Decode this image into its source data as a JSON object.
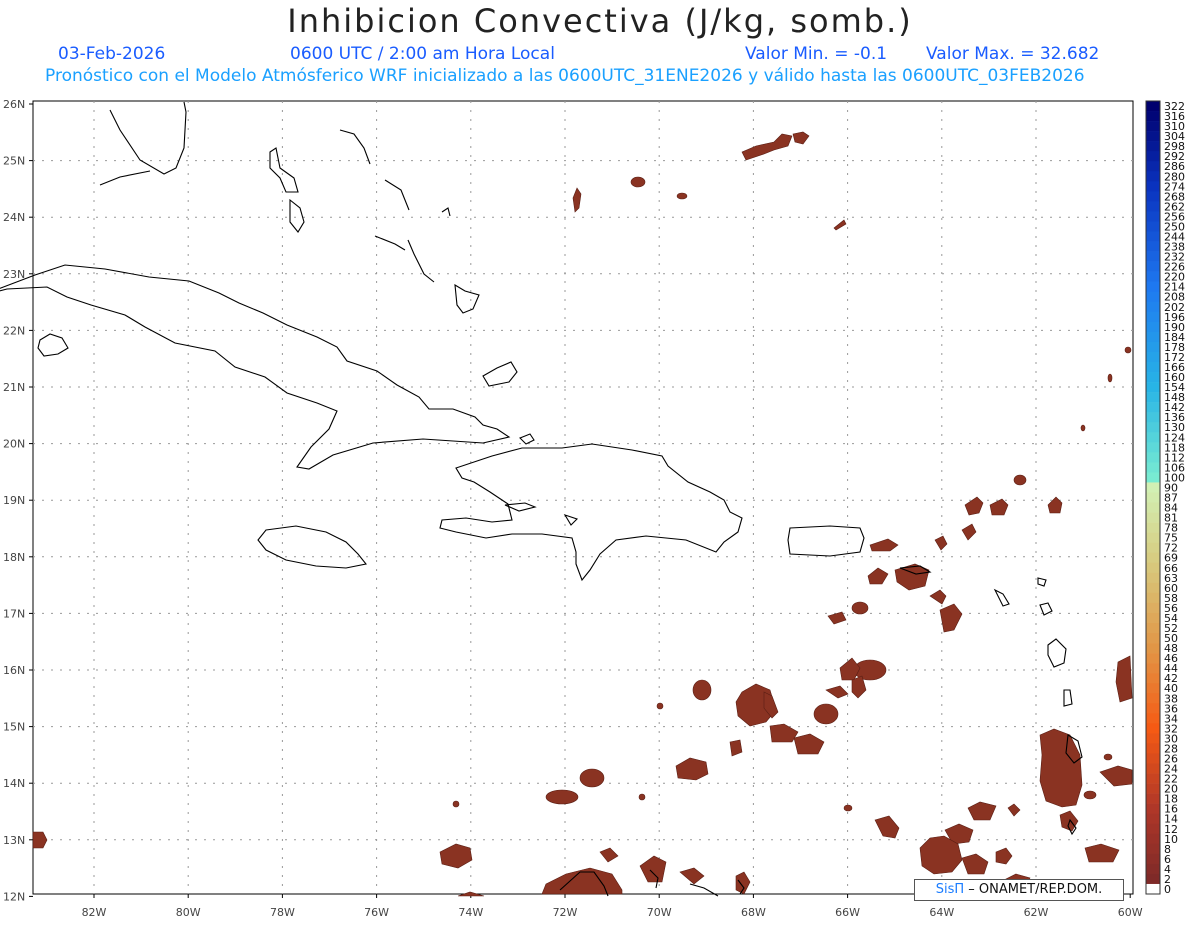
{
  "header": {
    "title": "Inhibicion Convectiva (J/kg, somb.)",
    "date": "03-Feb-2026",
    "time": "0600 UTC / 2:00 am Hora Local",
    "min_value": "Valor Min. = -0.1",
    "max_value": "Valor Max. = 32.682",
    "forecast_line": "Pronóstico con el Modelo Atmósferico WRF inicializado a las 0600UTC_31ENE2026 y válido hasta las  0600UTC_03FEB2026"
  },
  "axes": {
    "lat_labels": [
      "26N",
      "25N",
      "24N",
      "23N",
      "22N",
      "21N",
      "20N",
      "19N",
      "18N",
      "17N",
      "16N",
      "15N",
      "14N",
      "13N",
      "12N"
    ],
    "lon_labels": [
      "82W",
      "80W",
      "78W",
      "76W",
      "74W",
      "72W",
      "70W",
      "68W",
      "66W",
      "64W",
      "62W",
      "60W"
    ]
  },
  "colorbar": {
    "labels": [
      "322",
      "316",
      "310",
      "304",
      "298",
      "292",
      "286",
      "280",
      "274",
      "268",
      "262",
      "256",
      "250",
      "244",
      "238",
      "232",
      "226",
      "220",
      "214",
      "208",
      "202",
      "196",
      "190",
      "184",
      "178",
      "172",
      "166",
      "160",
      "154",
      "148",
      "142",
      "136",
      "130",
      "124",
      "118",
      "112",
      "106",
      "100",
      "90",
      "87",
      "84",
      "81",
      "78",
      "75",
      "72",
      "69",
      "66",
      "63",
      "60",
      "58",
      "56",
      "54",
      "52",
      "50",
      "48",
      "46",
      "44",
      "42",
      "40",
      "38",
      "36",
      "34",
      "32",
      "30",
      "28",
      "26",
      "24",
      "22",
      "20",
      "18",
      "16",
      "14",
      "12",
      "10",
      "8",
      "6",
      "4",
      "2",
      "0"
    ]
  },
  "credit": {
    "sis": "SisΠ",
    "text": " – ONAMET/REP.DOM."
  }
}
